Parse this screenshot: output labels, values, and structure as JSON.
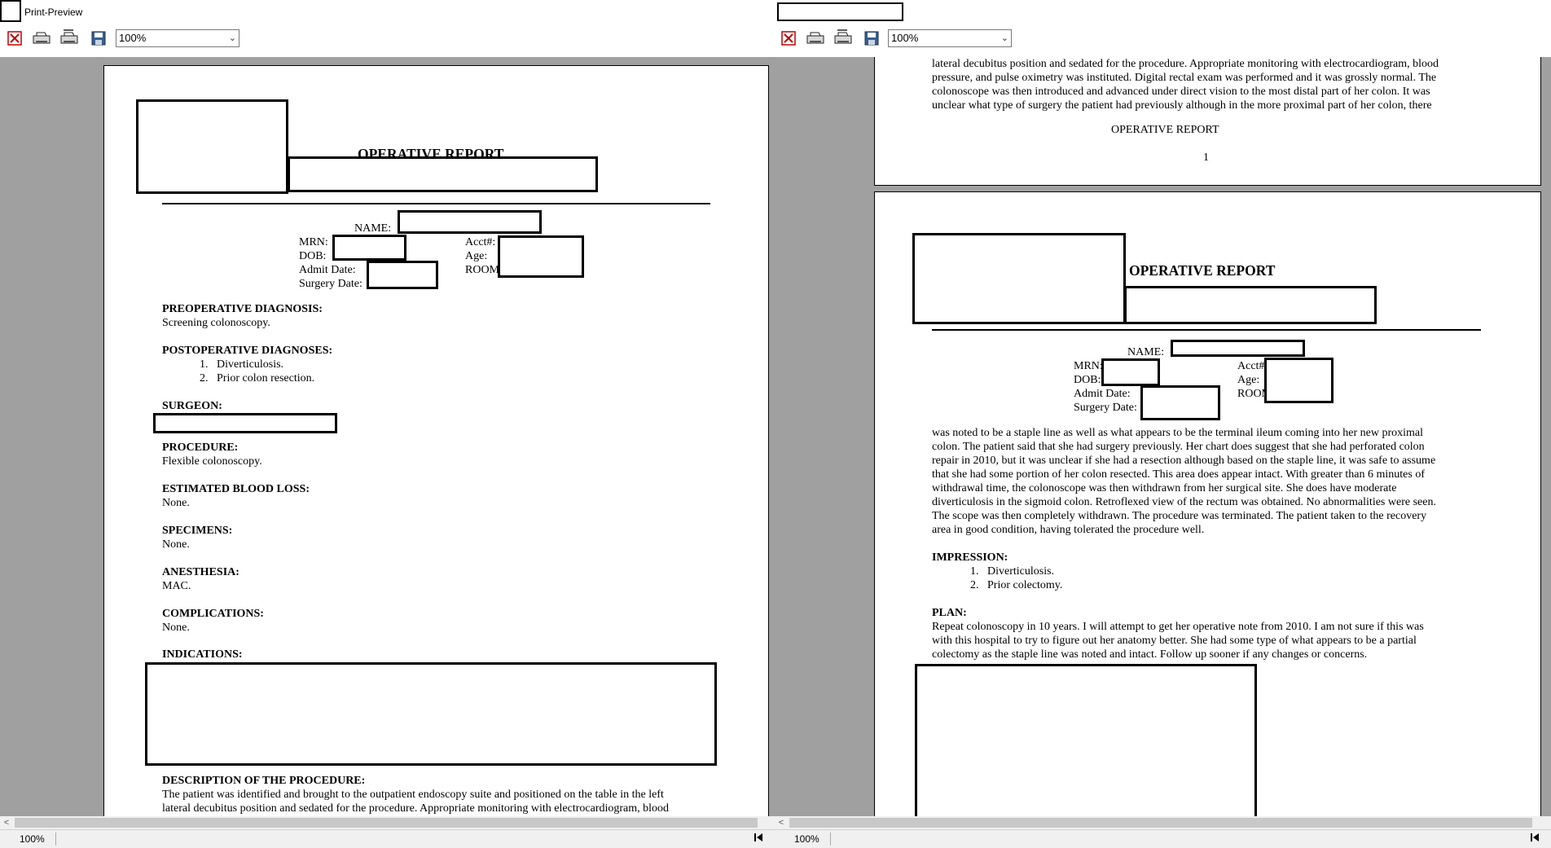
{
  "window_left": {
    "title": "Print-Preview",
    "zoom_select": "100%",
    "status_zoom": "100%",
    "page": {
      "report_title": "OPERATIVE REPORT",
      "name_label": "NAME:",
      "mrn_label": "MRN:",
      "dob_label": "DOB:",
      "admit_label": "Admit Date:",
      "surgery_label": "Surgery Date:",
      "acct_label": "Acct#:",
      "age_label": "Age:",
      "room_label": "ROOM",
      "sections": [
        {
          "heading": "PREOPERATIVE DIAGNOSIS:",
          "body": "Screening colonoscopy."
        },
        {
          "heading": "POSTOPERATIVE DIAGNOSES:",
          "items": [
            "1.   Diverticulosis.",
            "2.   Prior colon resection."
          ]
        },
        {
          "heading": "SURGEON:"
        },
        {
          "heading": "PROCEDURE:",
          "body": "Flexible colonoscopy."
        },
        {
          "heading": "ESTIMATED BLOOD LOSS:",
          "body": "None."
        },
        {
          "heading": "SPECIMENS:",
          "body": "None."
        },
        {
          "heading": "ANESTHESIA:",
          "body": "MAC."
        },
        {
          "heading": "COMPLICATIONS:",
          "body": "None."
        },
        {
          "heading": "INDICATIONS:"
        },
        {
          "heading": "DESCRIPTION OF THE PROCEDURE:",
          "lines": [
            "The patient was identified and brought to the outpatient endoscopy suite and positioned on the table in the left",
            "lateral decubitus position and sedated for the procedure.  Appropriate monitoring with electrocardiogram, blood"
          ]
        }
      ]
    }
  },
  "window_right": {
    "zoom_select": "100%",
    "status_zoom": "100%",
    "page1_tail": {
      "lines": [
        "lateral decubitus position and sedated for the procedure.  Appropriate monitoring with electrocardiogram, blood",
        "pressure, and pulse oximetry was instituted.  Digital rectal exam was performed and it was grossly normal.  The",
        "colonoscope was then introduced and advanced under direct vision to the most distal part of her colon.  It was",
        "unclear what type of surgery the patient had previously although in the more proximal part of her colon, there"
      ],
      "footer_title": "OPERATIVE REPORT",
      "page_number": "1"
    },
    "page2": {
      "report_title": "OPERATIVE REPORT",
      "name_label": "NAME:",
      "mrn_label": "MRN:",
      "dob_label": "DOB:",
      "admit_label": "Admit Date:",
      "surgery_label": "Surgery Date:",
      "acct_label": "Acct#:",
      "age_label": "Age:",
      "room_label": "ROOM",
      "body_lines": [
        "was noted to be a staple line as well as what appears to be the terminal ileum coming into her new proximal",
        "colon.  The patient said that she had surgery previously.  Her chart does suggest that she had perforated colon",
        "repair in 2010, but it was unclear if she had a resection although based on the staple line, it was safe to assume",
        "that she had some portion of her colon resected.  This area does appear intact.  With greater than 6 minutes of",
        "withdrawal time, the colonoscope was then  withdrawn from her surgical site.  She does have moderate",
        "diverticulosis in the sigmoid colon.  Retroflexed view of the rectum was obtained.  No abnormalities were seen.",
        "The scope was then completely withdrawn.  The procedure was terminated.  The patient taken to the recovery",
        "area in good condition, having tolerated the procedure well."
      ],
      "impression_heading": "IMPRESSION:",
      "impression_items": [
        "1.   Diverticulosis.",
        "2.   Prior colectomy."
      ],
      "plan_heading": "PLAN:",
      "plan_lines": [
        "Repeat colonoscopy in 10 years.  I will attempt to get her operative note from 2010.  I am not sure if this was",
        "with this hospital to try to figure out her anatomy better.  She had some type of what appears to be a partial",
        "colectomy as the staple line was noted and intact.  Follow up sooner if any changes or concerns."
      ]
    }
  },
  "icons": [
    "close-preview-icon",
    "print-icon",
    "print-setup-icon",
    "save-icon",
    "first-page-icon"
  ]
}
